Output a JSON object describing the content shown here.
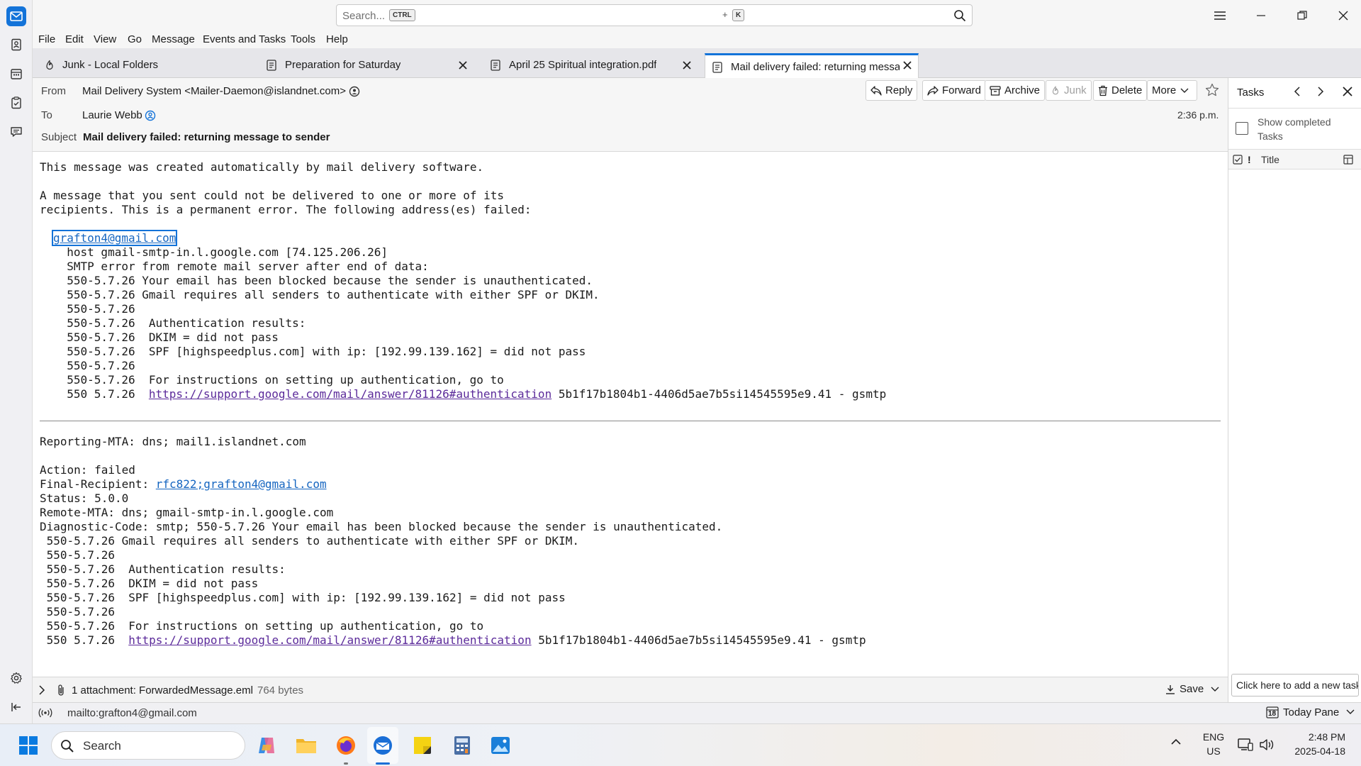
{
  "app": {
    "accent": "#1373d9",
    "link_color": "#1565c0",
    "visited_link_color": "#5b2a9a"
  },
  "spaces": {
    "items": [
      "mail-icon",
      "address-book-icon",
      "calendar-icon",
      "tasks-icon",
      "chat-icon"
    ],
    "bottom": [
      "settings-icon",
      "collapse-icon"
    ]
  },
  "search": {
    "placeholder": "Search...",
    "shortcut_1": "CTRL",
    "plus": "+",
    "shortcut_2": "K"
  },
  "menu": [
    "File",
    "Edit",
    "View",
    "Go",
    "Message",
    "Events and Tasks",
    "Tools",
    "Help"
  ],
  "tabs": [
    {
      "label": "Junk - Local Folders",
      "icon": "junk-icon"
    },
    {
      "label": "Preparation for Saturday",
      "icon": "message-icon"
    },
    {
      "label": "April 25 Spiritual integration.pdf",
      "icon": "message-icon"
    },
    {
      "label": "Mail delivery failed: returning message to sender",
      "icon": "message-icon",
      "active": true
    }
  ],
  "header": {
    "from_label": "From",
    "from_value": "Mail Delivery System <Mailer-Daemon@islandnet.com>",
    "to_label": "To",
    "to_value": "Laurie Webb",
    "subject_label": "Subject",
    "subject_value": "Mail delivery failed: returning message to sender",
    "time": "2:36 p.m.",
    "buttons": {
      "reply": "Reply",
      "forward": "Forward",
      "archive": "Archive",
      "junk": "Junk",
      "delete": "Delete",
      "more": "More"
    }
  },
  "body": {
    "l1": "This message was created automatically by mail delivery software.",
    "l2": "A message that you sent could not be delivered to one or more of its",
    "l3": "recipients. This is a permanent error. The following address(es) failed:",
    "addr": "grafton4@gmail.com",
    "d1": "  host gmail-smtp-in.l.google.com [74.125.206.26]",
    "d2": "  SMTP error from remote mail server after end of data:",
    "d3": "  550-5.7.26 Your email has been blocked because the sender is unauthenticated.",
    "d4": "  550-5.7.26 Gmail requires all senders to authenticate with either SPF or DKIM.",
    "d5": "  550-5.7.26",
    "d6": "  550-5.7.26  Authentication results:",
    "d7": "  550-5.7.26  DKIM = did not pass",
    "d8": "  550-5.7.26  SPF [highspeedplus.com] with ip: [192.99.139.162] = did not pass",
    "d9": "  550-5.7.26",
    "d10": "  550-5.7.26  For instructions on setting up authentication, go to",
    "d11_pre": "  550 5.7.26  ",
    "link": "https://support.google.com/mail/answer/81126#authentication",
    "d11_post": " 5b1f17b1804b1-4406d5ae7b5si14545595e9.41 - gsmtp",
    "r1": "Reporting-MTA: dns; mail1.islandnet.com",
    "r2": "Action: failed",
    "r3_pre": "Final-Recipient: ",
    "r3_link": "rfc822;grafton4@gmail.com",
    "r4": "Status: 5.0.0",
    "r5": "Remote-MTA: dns; gmail-smtp-in.l.google.com",
    "r6": "Diagnostic-Code: smtp; 550-5.7.26 Your email has been blocked because the sender is unauthenticated.",
    "e1": " 550-5.7.26 Gmail requires all senders to authenticate with either SPF or DKIM.",
    "e2": " 550-5.7.26",
    "e3": " 550-5.7.26  Authentication results:",
    "e4": " 550-5.7.26  DKIM = did not pass",
    "e5": " 550-5.7.26  SPF [highspeedplus.com] with ip: [192.99.139.162] = did not pass",
    "e6": " 550-5.7.26",
    "e7": " 550-5.7.26  For instructions on setting up authentication, go to",
    "e8_pre": " 550 5.7.26  "
  },
  "attachments": {
    "label": "1 attachment: ForwardedMessage.eml",
    "size": "764 bytes",
    "save": "Save"
  },
  "tasks": {
    "title": "Tasks",
    "show_completed": "Show completed Tasks",
    "col_title": "Title",
    "col_priority": "!",
    "new_task_placeholder": "Click here to add a new task"
  },
  "status": {
    "text": "mailto:grafton4@gmail.com",
    "today_pane": "Today Pane",
    "today_day": "18"
  },
  "taskbar": {
    "search_placeholder": "Search",
    "lang_1": "ENG",
    "lang_2": "US",
    "time": "2:48 PM",
    "date": "2025-04-18"
  }
}
